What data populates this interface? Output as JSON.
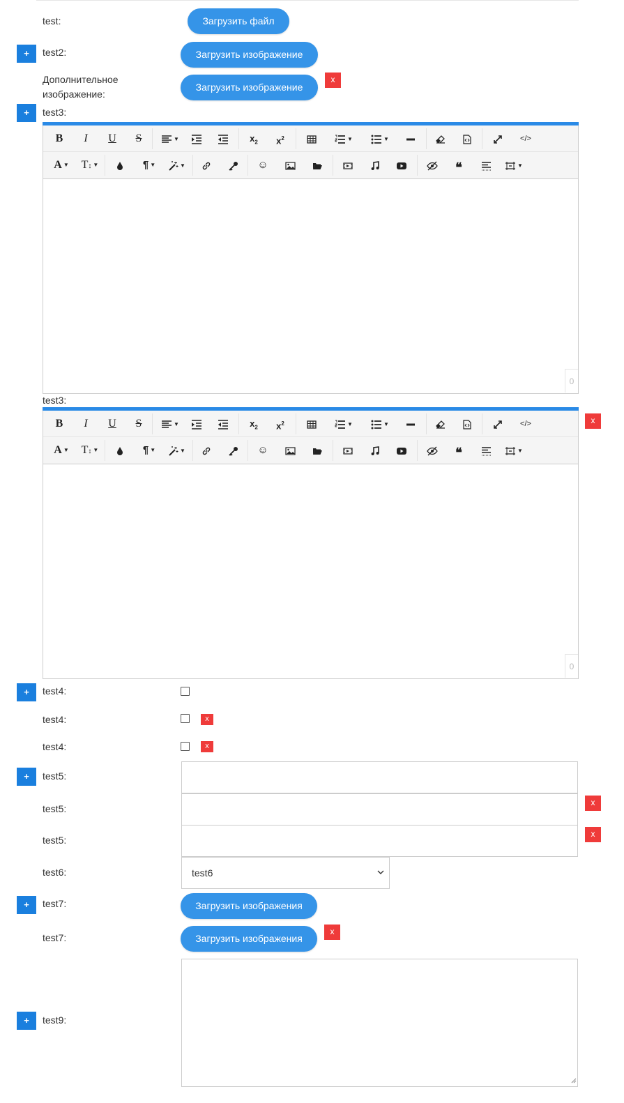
{
  "fields": {
    "test1": {
      "label": "test:",
      "button": "Загрузить файл"
    },
    "test2": {
      "label": "test2:",
      "button": "Загрузить изображение"
    },
    "extra_image": {
      "label_line1": "Дополнительное",
      "label_line2": "изображение:",
      "button": "Загрузить изображение",
      "remove": "x"
    },
    "test3_a": {
      "label": "test3:",
      "counter": "0"
    },
    "test3_b": {
      "label": "test3:",
      "counter": "0",
      "remove": "x"
    },
    "test4_a": {
      "label": "test4:"
    },
    "test4_b": {
      "label": "test4:",
      "remove": "x"
    },
    "test4_c": {
      "label": "test4:",
      "remove": "x"
    },
    "test5_a": {
      "label": "test5:",
      "value": ""
    },
    "test5_b": {
      "label": "test5:",
      "value": "",
      "remove": "x"
    },
    "test5_c": {
      "label": "test5:",
      "value": "",
      "remove": "x"
    },
    "test6": {
      "label": "test6:",
      "selected": "test6"
    },
    "test7_a": {
      "label": "test7:",
      "button": "Загрузить изображения"
    },
    "test7_b": {
      "label": "test7:",
      "button": "Загрузить изображения",
      "remove": "x"
    },
    "test9": {
      "label": "test9:",
      "value": ""
    }
  },
  "add_button_label": "+",
  "toolbar": {
    "bold": "B",
    "italic": "I",
    "underline": "U",
    "strike": "S",
    "font_color": "A",
    "font_size": "T",
    "paragraph": "¶",
    "quote": "❝",
    "emoji": "☺",
    "icons": [
      "bold-icon",
      "italic-icon",
      "underline-icon",
      "strikethrough-icon",
      "align-icon",
      "indent-icon",
      "outdent-icon",
      "subscript-icon",
      "superscript-icon",
      "table-icon",
      "ordered-list-icon",
      "unordered-list-icon",
      "horizontal-rule-icon",
      "eraser-icon",
      "source-file-icon",
      "fullscreen-icon",
      "code-view-icon",
      "font-color-icon",
      "font-size-icon",
      "ink-drop-icon",
      "paragraph-icon",
      "magic-wand-icon",
      "link-icon",
      "key-icon",
      "emoji-icon",
      "image-icon",
      "folder-icon",
      "video-icon",
      "audio-icon",
      "youtube-icon",
      "hide-icon",
      "quote-icon",
      "text-align-icon",
      "line-height-icon"
    ]
  },
  "colors": {
    "plus": "#1a7fde",
    "remove": "#ef3b3a",
    "button": "#3594e8",
    "editor_bar": "#2a8ae6"
  }
}
